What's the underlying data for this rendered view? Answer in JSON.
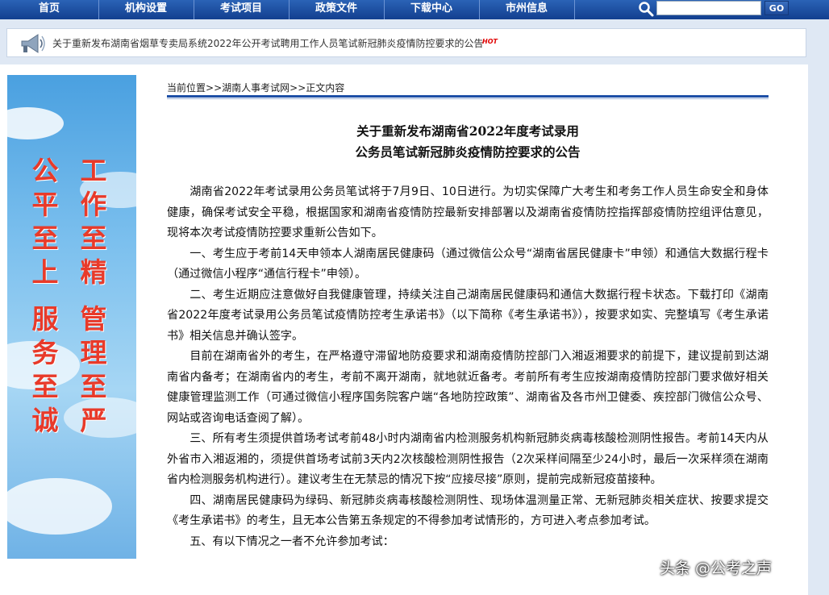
{
  "nav": {
    "items": [
      "首页",
      "机构设置",
      "考试项目",
      "政策文件",
      "下载中心",
      "市州信息"
    ],
    "search_placeholder": "",
    "search_button": "GO"
  },
  "notice": {
    "text": "关于重新发布湖南省烟草专卖局系统2022年公开考试聘用工作人员笔试新冠肺炎疫情防控要求的公告",
    "badge": "HOT"
  },
  "banner": {
    "columns": [
      [
        "公",
        "平",
        "至",
        "上"
      ],
      [
        "工",
        "作",
        "至",
        "精"
      ],
      [
        "服",
        "务",
        "至",
        "诚"
      ],
      [
        "管",
        "理",
        "至",
        "严"
      ]
    ]
  },
  "breadcrumb": {
    "label": "当前位置",
    "sep": ">>",
    "items": [
      "湖南人事考试网",
      "正文内容"
    ]
  },
  "article": {
    "title_line1": "关于重新发布湖南省2022年度考试录用",
    "title_line2": "公务员笔试新冠肺炎疫情防控要求的公告",
    "paragraphs": [
      "湖南省2022年考试录用公务员笔试将于7月9日、10日进行。为切实保障广大考生和考务工作人员生命安全和身体健康，确保考试安全平稳，根据国家和湖南省疫情防控最新安排部署以及湖南省疫情防控指挥部疫情防控组评估意见，现将本次考试疫情防控要求重新公告如下。",
      "一、考生应于考前14天申领本人湖南居民健康码（通过微信公众号“湖南省居民健康卡”申领）和通信大数据行程卡（通过微信小程序“通信行程卡”申领）。",
      "二、考生近期应注意做好自我健康管理，持续关注自己湖南居民健康码和通信大数据行程卡状态。下载打印《湖南省2022年度考试录用公务员笔试疫情防控考生承诺书》（以下简称《考生承诺书》），按要求如实、完整填写《考生承诺书》相关信息并确认签字。",
      "目前在湖南省外的考生，在严格遵守滞留地防疫要求和湖南疫情防控部门入湘返湘要求的前提下，建议提前到达湖南省内备考；在湖南省内的考生，考前不离开湖南，就地就近备考。考前所有考生应按湖南疫情防控部门要求做好相关健康管理监测工作（可通过微信小程序国务院客户端“各地防控政策”、湖南省及各市州卫健委、疾控部门微信公众号、网站或咨询电话查阅了解）。",
      "三、所有考生须提供首场考试考前48小时内湖南省内检测服务机构新冠肺炎病毒核酸检测阴性报告。考前14天内从外省市入湘返湘的，须提供首场考试前3天内2次核酸检测阴性报告（2次采样间隔至少24小时，最后一次采样须在湖南省内检测服务机构进行）。建议考生在无禁忌的情况下按“应接尽接”原则，提前完成新冠疫苗接种。",
      "四、湖南居民健康码为绿码、新冠肺炎病毒核酸检测阴性、现场体温测量正常、无新冠肺炎相关症状、按要求提交《考生承诺书》的考生，且无本公告第五条规定的不得参加考试情形的，方可进入考点参加考试。",
      "五、有以下情况之一者不允许参加考试："
    ]
  },
  "watermark": "头条 @公考之声"
}
